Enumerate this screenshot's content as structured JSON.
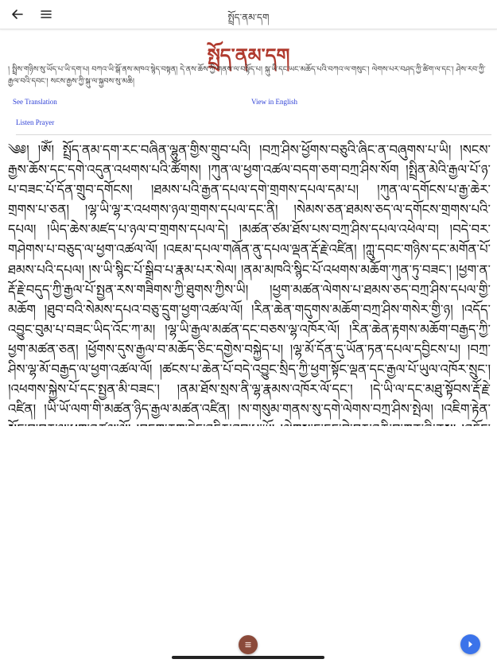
{
  "status_bar": {
    "time": "",
    "battery": ""
  },
  "app_bar": {
    "title": "སྤྲོད་ནམ་དག",
    "back_icon": "arrow-left-icon",
    "menu_icon": "hamburger-menu-icon"
  },
  "page": {
    "title": "སྤྲོད་ནམ་དག",
    "subtitle": "། སྤྲིས་གཉིས་སུ་ཡོད་པ་ཡི་དག་པ། བཀའ་ཡི་སྒོ་ནས་མཁའ་སྙེད་བསྟན། དེ་ནས་ཆོས་ཀྱི་གནས་ལ་བསྟོད་པ། སྐུ་ཡི་དང་ཡང་མཆོད་པའི་བཀའ་ལ་གསུང་། ལེགས་པར་བཤད་ཀྱི་ཚིག་ལ་དང་། ཤེས་རབ་ཀྱི་རྒྱལ་བའི་དབང་། སངས་རྒྱས་ཀྱི་སྐུ་ལ་སྐྱབས་སུ་མཆི།",
    "links": {
      "see_translation": "See Translation",
      "view_in_english": "View in English",
      "listen_prayer": "Listen Prayer"
    },
    "prayer_text": "༄༅། །ཨོཾ། སྤྲོད་ནམ་དག་རང་བཞིན་ལྷུན་གྱིས་གྲུབ་པའི། །བཀྲ་ཤིས་ཕྱོགས་བཅུའི་ཞིང་ན་བཞུགས་པ་ཡི། །སངས་རྒྱས་ཆོས་དང་དགེ་འདུན་འཕགས་པའི་ཚོགས། །ཀུན་ལ་ཕྱག་འཚལ་བདག་ཅག་བཀྲ་ཤིས་སོག །སྤྲིན་མེའི་རྒྱལ་པོ་ཉ་པ་བཟང་པོ་དོན་གྲུབ་དགོངས། །ཐམས་པའི་རྒྱན་དཔལ་དགེ་གྲགས་དཔལ་དམ་པ། །ཀུན་ལ་དགོངས་པ་རྒྱ་ཆེར་གྲགས་པ་ཅན། །ལྷ་ཡི་ལྷ་ར་འཕགས་ཉལ་གྲགས་དཔལ་དང་ནི། །སེམས་ཅན་ཐམས་ཅད་ལ་དགོངས་གྲགས་པའི་དཔལ། །ཡིད་ཆེས་མཛད་པ་ཉལ་བ་གྲགས་དཔལ་དེ། །མཚན་ཙམ་ཐོས་པས་བཀྲ་ཤིས་དཔལ་འཕེལ་བ། །བདེ་བར་གཤེགས་པ་བཅུད་ལ་ཕྱག་འཚལ་ལོ། །འཇམ་དཔལ་གཞོན་ནུ་དཔལ་ལྡན་རྡོ་རྗེ་འཛིན། །ཀླུ་དབང་གཉིས་དང་མགོན་པོ་ཐམས་པའི་དཔལ། །ས་ཡི་སྙིང་པོ་སྒྲིབ་པ་རྣམ་པར་སེལ། །ནམ་མཁའི་སྙིང་པོ་འཕགས་མཆོག་ཀུན་ཏུ་བཟང་། །ཕྱག་ན་རྡོ་རྗེ་བདུད་ཀྱི་རྒྱལ་པོ་སྤྱན་རས་གཟིགས་ཀྱི་ཐུགས་ཀྱིས་ཡི། །ཕྱག་མཚན་ལེགས་པ་ཐམས་ཅད་བཀྲ་ཤིས་དཔལ་གྱི་མཆོག །ཐུབ་བའི་སེམས་དཔའ་བཅུ་དྲུག་ཕྱག་འཚལ་ལོ། །རིན་ཆེན་གདུགས་མཆོག་བཀྲ་ཤིས་གསེར་གྱི་ཉ། །འདོད་འབྱུང་བུམ་པ་བཟང་ཡིད་འོང་ཀ་མ། །ལྷ་ཡི་རྒྱལ་མཚན་དང་བཅས་ལྷ་འཁོར་ལོ། །རིན་ཆེན་རྟགས་མཆོག་བརྒྱད་ཀྱི་ཕྱག་མཚན་ཅན། །ཕྱོགས་དུས་རྒྱལ་བ་མཆོད་ཅིང་དགྱེས་བསྐྱེད་པ། །ལྷ་མོ་དོན་དུ་ཡོན་ཏན་དཔལ་དབྱིངས་པ། །བཀྲ་ཤིས་ལྷ་མོ་བརྒྱད་ལ་ཕྱག་འཚལ་ལོ། །ཚངས་པ་ཆེན་པོ་བདེ་འབྱུང་སྲིད་ཀྱི་ཕྱག་སྟོང་ལྡན་དང་རྒྱལ་པོ་ཡུལ་འཁོར་སྲུང་། །འཕགས་སྐྱེས་པོ་དང་སྤྱན་མི་བཟང་། །ནམ་ཐོས་སྲས་ནི་ལྷ་རྣམས་འཁོར་ལོ་དང་། །དེ་ཡི་ལ་དང་མཐུ་སྟོབས་རྡོ་རྗེ་འཛིན། །ཡི་ཡོ་ལག་གི་མཚན་ཉིད་རྒྱལ་མཚན་འཛིན། །ས་གསུམ་གནས་སུ་དགེ་ལེགས་བཀྲ་ཤིས་སྤེལ། །འཇིག་རྟེན་སྐྱོང་བ་བཅུ་ལ་ཕྱག་འཚལ་ལོ། །བདག་ཅག་དེང་འདིར་ཐུབ་པ་ཡོ། །ལེགས་ང་དང་བྱེ་བར་འཆི་བ་ཀུན་ཞི་ནས། །འདོད་དོན་དཔལ་འཕེལ་བ་སམ། དོན་ཡིད་བཞིན་འགྲུབ། །བཀྲ་ཤིས་བདེ་ལེགས་ཕུན་སུམ་ཚོགས་པར་ཤོག །"
  },
  "bottom": {
    "toc_icon": "list-icon",
    "next_icon": "chevron-right-icon"
  },
  "colors": {
    "title_red": "#b03a2e",
    "link_blue": "#2d3fd6",
    "toc_button": "#8b4a3a",
    "next_button": "#3b73ea"
  }
}
